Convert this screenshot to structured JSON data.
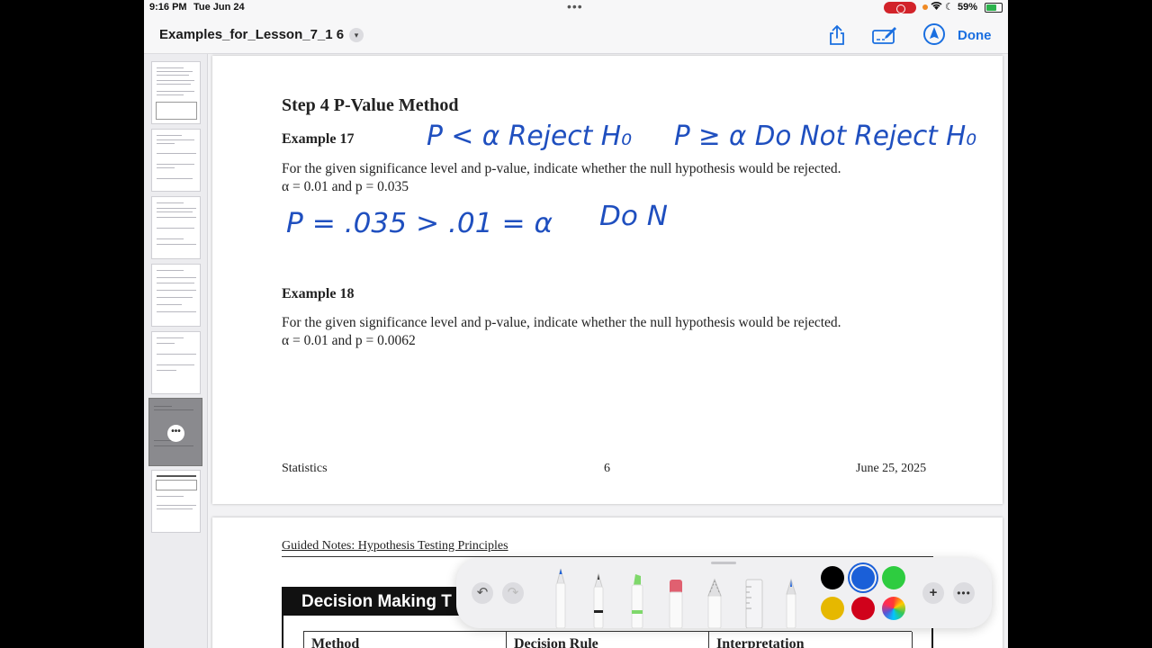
{
  "status_bar": {
    "time": "9:16 PM",
    "date": "Tue Jun 24",
    "battery": "59%"
  },
  "toolbar": {
    "title": "Examples_for_Lesson_7_1 6",
    "done_label": "Done",
    "accent_color": "#1a6fe0"
  },
  "page1": {
    "heading": "Step 4 P-Value Method",
    "example17": {
      "title": "Example 17",
      "line1": "For the given significance level and p-value, indicate whether the null hypothesis would be rejected.",
      "line2": "α = 0.01 and p = 0.035"
    },
    "example18": {
      "title": "Example 18",
      "line1": "For the given significance level and p-value, indicate whether the null hypothesis would be rejected.",
      "line2": "α = 0.01 and p = 0.0062"
    },
    "footer": {
      "left": "Statistics",
      "center": "6",
      "right": "June 25, 2025"
    },
    "handwriting": {
      "rule1": "P < α Reject H₀",
      "rule2": "P ≥ α Do Not Reject H₀",
      "work": "P = .035 > .01 = α",
      "partial": "Do N",
      "ink_color": "#1f4fbf"
    }
  },
  "page2": {
    "header": "Guided Notes: Hypothesis Testing Principles",
    "box_title": "Decision Making T",
    "columns": [
      "Method",
      "Decision Rule",
      "Interpretation"
    ]
  },
  "palette": {
    "colors": [
      "#000000",
      "#1a5fd8",
      "#2ecc40",
      "#e6b800",
      "#d0021b"
    ],
    "selected_color": "#1a5fd8"
  }
}
